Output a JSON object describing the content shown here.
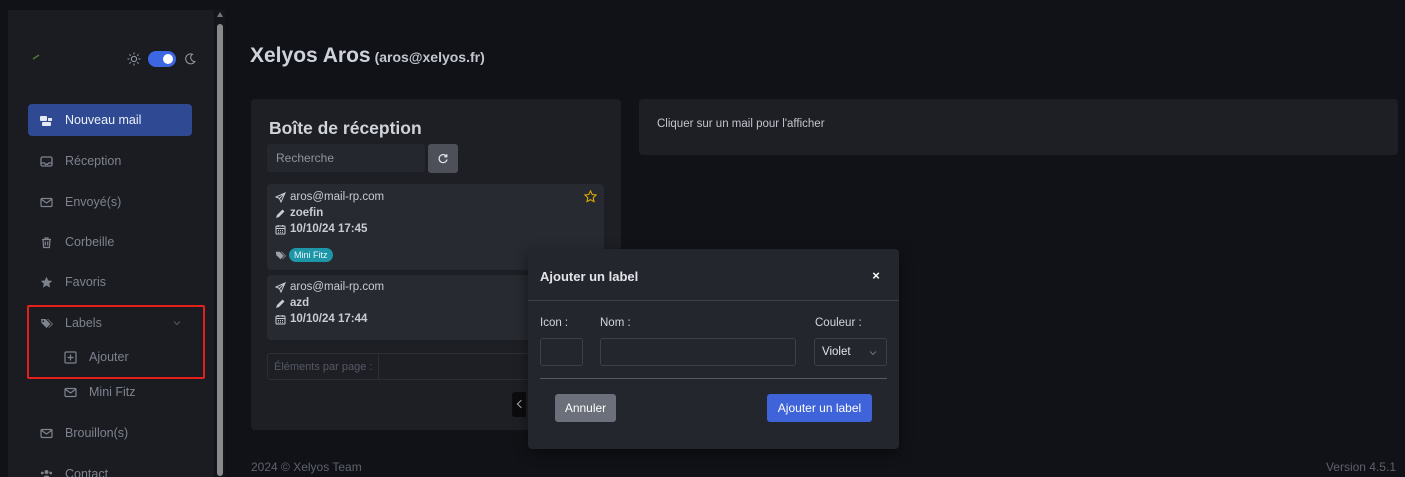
{
  "sidebar": {
    "logo_icon": "logo-icon",
    "theme": {
      "sun_icon": "sun-icon",
      "moon_icon": "moon-icon",
      "mode": "dark"
    },
    "items": {
      "new_mail": {
        "label": "Nouveau mail",
        "icon": "compose-icon"
      },
      "inbox": {
        "label": "Réception",
        "icon": "inbox-icon"
      },
      "sent": {
        "label": "Envoyé(s)",
        "icon": "envelope-icon"
      },
      "trash": {
        "label": "Corbeille",
        "icon": "trash-icon"
      },
      "favorites": {
        "label": "Favoris",
        "icon": "star-icon"
      },
      "labels": {
        "label": "Labels",
        "icon": "tags-icon"
      },
      "add_label": {
        "label": "Ajouter",
        "icon": "plus-square-icon"
      },
      "mini_fitz": {
        "label": "Mini Fitz",
        "icon": "envelope-icon"
      },
      "drafts": {
        "label": "Brouillon(s)",
        "icon": "envelope-icon"
      },
      "contact": {
        "label": "Contact",
        "icon": "users-icon"
      }
    }
  },
  "header": {
    "name": "Xelyos Aros",
    "email": "(aros@xelyos.fr)"
  },
  "inbox": {
    "title": "Boîte de réception",
    "search_placeholder": "Recherche",
    "mails": [
      {
        "sender": "aros@mail-rp.com",
        "recipient": "zoefin",
        "date": "10/10/24 17:45",
        "label": "Mini Fitz",
        "starred": false
      },
      {
        "sender": "aros@mail-rp.com",
        "recipient": "azd",
        "date": "10/10/24 17:44"
      }
    ],
    "per_page_label": "Éléments par page :"
  },
  "preview": {
    "placeholder": "Cliquer sur un mail pour l'afficher"
  },
  "footer": {
    "copyright": "2024 © Xelyos Team",
    "version": "Version 4.5.1"
  },
  "modal": {
    "title": "Ajouter un label",
    "close": "×",
    "icon_label": "Icon :",
    "name_label": "Nom :",
    "color_label": "Couleur :",
    "color_value": "Violet",
    "cancel": "Annuler",
    "submit": "Ajouter un label"
  },
  "colors": {
    "background": "#111217",
    "sidebar": "#1a1c22",
    "card": "#1d1f25",
    "active_item": "#2f4993",
    "primary": "#3f63d8",
    "label_badge": "#1f96a8",
    "star": "#e0a800",
    "highlight": "#e3201c"
  }
}
